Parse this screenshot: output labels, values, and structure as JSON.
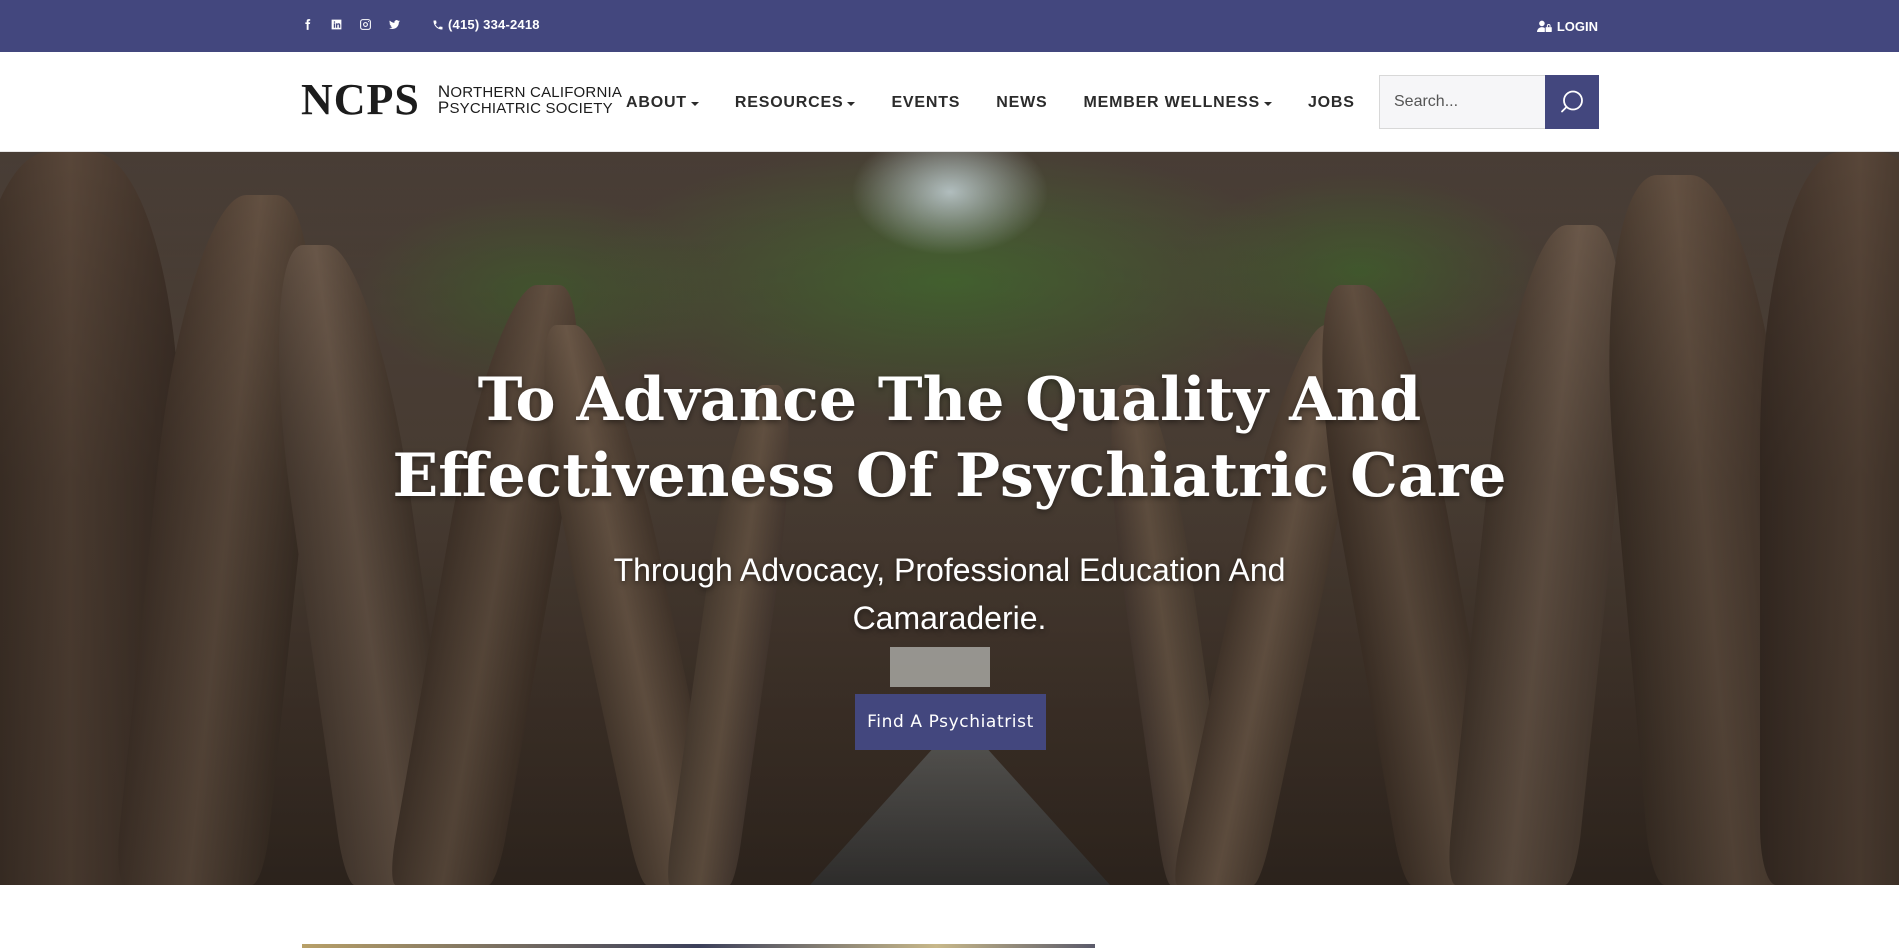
{
  "topbar": {
    "social_icons": [
      "facebook-icon",
      "linkedin-icon",
      "instagram-icon",
      "twitter-icon"
    ],
    "phone": "(415) 334-2418",
    "login": "LOGIN"
  },
  "header": {
    "logo_mark": "NCPS",
    "logo_line1": "Northern California",
    "logo_line2": "Psychiatric Society",
    "nav": [
      {
        "label": "ABOUT",
        "dropdown": true
      },
      {
        "label": "RESOURCES",
        "dropdown": true
      },
      {
        "label": "EVENTS",
        "dropdown": false
      },
      {
        "label": "NEWS",
        "dropdown": false
      },
      {
        "label": "MEMBER WELLNESS",
        "dropdown": true
      },
      {
        "label": "JOBS",
        "dropdown": false
      }
    ],
    "search_placeholder": "Search..."
  },
  "hero": {
    "title": "To Advance The Quality And Effectiveness Of Psychiatric Care",
    "subtitle": "Through Advocacy, Professional Education And Camaraderie.",
    "cta": "Find A Psychiatrist"
  },
  "colors": {
    "brand": "#43477e",
    "white": "#ffffff"
  }
}
